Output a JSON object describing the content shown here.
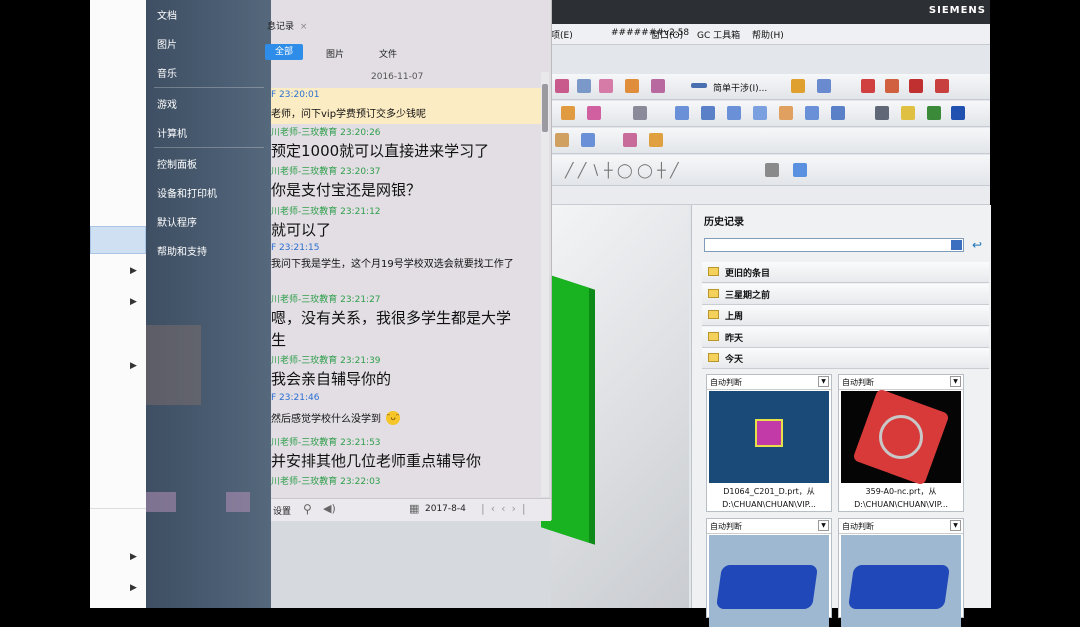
{
  "start_menu": {
    "items": [
      "文档",
      "图片",
      "音乐",
      "游戏",
      "计算机",
      "控制面板",
      "设备和打印机",
      "默认程序",
      "帮助和支持"
    ]
  },
  "chat": {
    "tab_title": "息记录",
    "filters": {
      "all": "全部",
      "images": "图片",
      "files": "文件"
    },
    "date": "2016-11-07",
    "messages": [
      {
        "who": "F 23:20:01",
        "role": "me",
        "text": "老师，问下vip学费预订交多少钱呢",
        "size": "small"
      },
      {
        "who": "川老师-三玫教育 23:20:26",
        "role": "them",
        "text": "预定1000就可以直接进来学习了",
        "size": "large"
      },
      {
        "who": "川老师-三玫教育 23:20:37",
        "role": "them",
        "text": "你是支付宝还是网银？",
        "size": "large"
      },
      {
        "who": "川老师-三玫教育 23:21:12",
        "role": "them",
        "text": "就可以了",
        "size": "large"
      },
      {
        "who": "F 23:21:15",
        "role": "me",
        "text": "我问下我是学生，这个月19号学校双选会就要找工作了",
        "size": "small"
      },
      {
        "who": "川老师-三玫教育 23:21:27",
        "role": "them",
        "text": "嗯，没有关系，我很多学生都是大学生",
        "size": "large"
      },
      {
        "who": "川老师-三玫教育 23:21:39",
        "role": "them",
        "text": "我会亲自辅导你的",
        "size": "large"
      },
      {
        "who": "F 23:21:46",
        "role": "me",
        "text": "然后感觉学校什么没学到",
        "size": "small",
        "emoji": "laugh-emoji"
      },
      {
        "who": "川老师-三玫教育 23:21:53",
        "role": "them",
        "text": "并安排其他几位老师重点辅导你",
        "size": "large"
      },
      {
        "who": "川老师-三玫教育 23:22:03",
        "role": "them",
        "text": "",
        "size": "large"
      }
    ],
    "footer": {
      "settings": "设置",
      "date": "2017-8-4"
    }
  },
  "nx": {
    "brand": "SIEMENS",
    "menus": [
      "项(E)",
      "#######v2.58",
      "窗口(O)",
      "GC 工具箱",
      "帮助(H)"
    ],
    "toolbar_text": "简单干涉(I)...",
    "history": {
      "title": "历史记录",
      "groups": [
        "更旧的条目",
        "三星期之前",
        "上周",
        "昨天",
        "今天"
      ],
      "cards": [
        {
          "label": "自动判断",
          "caption1": "D1064_C201_D.prt，从",
          "caption2": "D:\\CHUAN\\CHUAN\\VIP..."
        },
        {
          "label": "自动判断",
          "caption1": "359-A0-nc.prt，从",
          "caption2": "D:\\CHUAN\\CHUAN\\VIP..."
        },
        {
          "label": "自动判断",
          "caption1": "",
          "caption2": ""
        },
        {
          "label": "自动判断",
          "caption1": "",
          "caption2": ""
        }
      ]
    }
  },
  "colors": {
    "accent": "#2e8de8",
    "them": "#2f9e4a",
    "me": "#2b6fd1",
    "highlight": "#fcecc3",
    "model": "#19b322"
  }
}
